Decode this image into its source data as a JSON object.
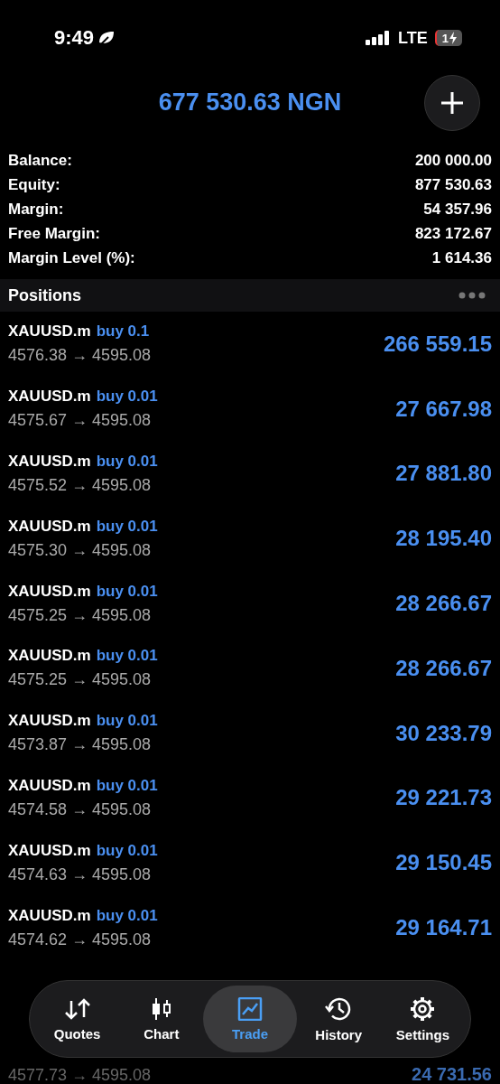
{
  "status_bar": {
    "time": "9:49",
    "network": "LTE",
    "battery": "1"
  },
  "header": {
    "title": "677 530.63 NGN"
  },
  "account": [
    {
      "label": "Balance:",
      "value": "200 000.00"
    },
    {
      "label": "Equity:",
      "value": "877 530.63"
    },
    {
      "label": "Margin:",
      "value": "54 357.96"
    },
    {
      "label": "Free Margin:",
      "value": "823 172.67"
    },
    {
      "label": "Margin Level (%):",
      "value": "1 614.36"
    }
  ],
  "positions": {
    "title": "Positions",
    "rows": [
      {
        "kind": "full",
        "symbol": "XAUUSD.m",
        "order": "buy 0.1",
        "prices": "4576.38 → 4595.08",
        "profit": "266 559.15"
      },
      {
        "kind": "full",
        "symbol": "XAUUSD.m",
        "order": "buy 0.01",
        "prices": "4575.67 → 4595.08",
        "profit": "27 667.98"
      },
      {
        "kind": "full",
        "symbol": "XAUUSD.m",
        "order": "buy 0.01",
        "prices": "4575.52 → 4595.08",
        "profit": "27 881.80"
      },
      {
        "kind": "full",
        "symbol": "XAUUSD.m",
        "order": "buy 0.01",
        "prices": "4575.30 → 4595.08",
        "profit": "28 195.40"
      },
      {
        "kind": "full",
        "symbol": "XAUUSD.m",
        "order": "buy 0.01",
        "prices": "4575.25 → 4595.08",
        "profit": "28 266.67"
      },
      {
        "kind": "full",
        "symbol": "XAUUSD.m",
        "order": "buy 0.01",
        "prices": "4575.25 → 4595.08",
        "profit": "28 266.67"
      },
      {
        "kind": "full",
        "symbol": "XAUUSD.m",
        "order": "buy 0.01",
        "prices": "4573.87 → 4595.08",
        "profit": "30 233.79"
      },
      {
        "kind": "full",
        "symbol": "XAUUSD.m",
        "order": "buy 0.01",
        "prices": "4574.58 → 4595.08",
        "profit": "29 221.73"
      },
      {
        "kind": "full",
        "symbol": "XAUUSD.m",
        "order": "buy 0.01",
        "prices": "4574.63 → 4595.08",
        "profit": "29 150.45"
      },
      {
        "kind": "full",
        "symbol": "XAUUSD.m",
        "order": "buy 0.01",
        "prices": "4574.62 → 4595.08",
        "profit": "29 164.71"
      },
      {
        "kind": "partial",
        "prices": "4577.73 → 4595.08",
        "profit": "24 731.56"
      }
    ]
  },
  "tab_bar": [
    {
      "kind": "quotes",
      "label": "Quotes",
      "selected": false
    },
    {
      "kind": "chart",
      "label": "Chart",
      "selected": false
    },
    {
      "kind": "trade",
      "label": "Trade",
      "selected": true
    },
    {
      "kind": "history",
      "label": "History",
      "selected": false
    },
    {
      "kind": "settings",
      "label": "Settings",
      "selected": false
    }
  ]
}
